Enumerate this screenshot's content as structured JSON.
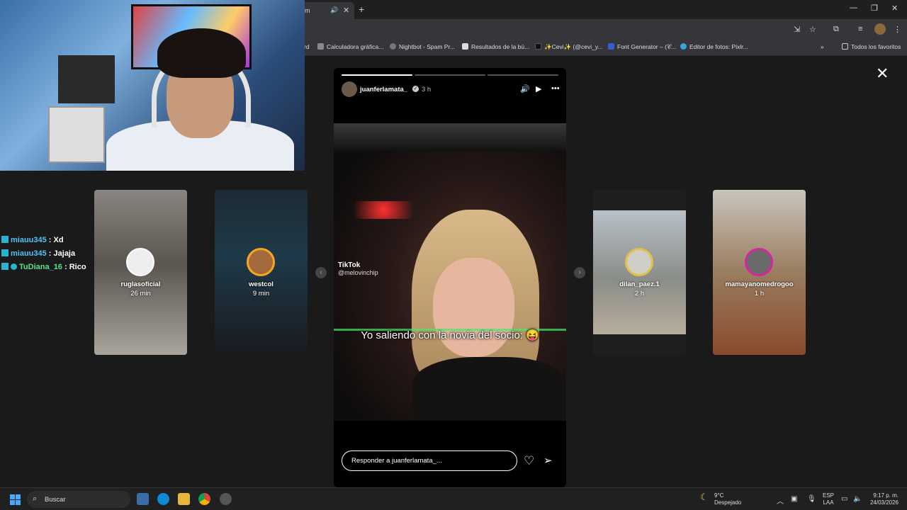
{
  "browser": {
    "tab_title": "m",
    "bookmarks": [
      {
        "label": "rd"
      },
      {
        "label": "Calculadora gráfica..."
      },
      {
        "label": "Nightbot - Spam Pr..."
      },
      {
        "label": "Resultados de la bú..."
      },
      {
        "label": "✨Cevi✨ (@cevi_y..."
      },
      {
        "label": "Font Generator – (𝒞..."
      },
      {
        "label": "Editor de fotos: Pixlr..."
      },
      {
        "label": "Todos los favoritos"
      }
    ],
    "more_label": "»"
  },
  "chat": [
    {
      "user": "miauu345",
      "msg": " : Xd"
    },
    {
      "user": "miauu345",
      "msg": " : Jajaja"
    },
    {
      "user": "TuDiana_16",
      "msg": " : Rico"
    }
  ],
  "side_stories": [
    {
      "name": "ruglasoficial",
      "time": "26 min"
    },
    {
      "name": "westcol",
      "time": "9 min"
    },
    {
      "name": "dilan_paez.1",
      "time": "2 h"
    },
    {
      "name": "mamayanomedrogoo",
      "time": "1 h"
    }
  ],
  "story": {
    "username": "juanferlamata_",
    "time_ago": "3 h",
    "progress_segments": 3,
    "active_segment": 1,
    "watermark_brand": "TikTok",
    "watermark_handle": "@melovinchip",
    "caption": "Yo saliendo con la novia del socio: 😝",
    "reply_placeholder": "Responder a juanferlamata_..."
  },
  "taskbar": {
    "search_label": "Buscar",
    "weather_temp": "9°C",
    "weather_desc": "Despejado",
    "lang_1": "ESP",
    "lang_2": "LAA",
    "time": "9:17 p. m.",
    "date": "24/03/2026"
  },
  "colors": {
    "chat_user": "#4fc3f7",
    "chat_user_alt": "#53e38a",
    "story_ring": "#d6249f"
  }
}
